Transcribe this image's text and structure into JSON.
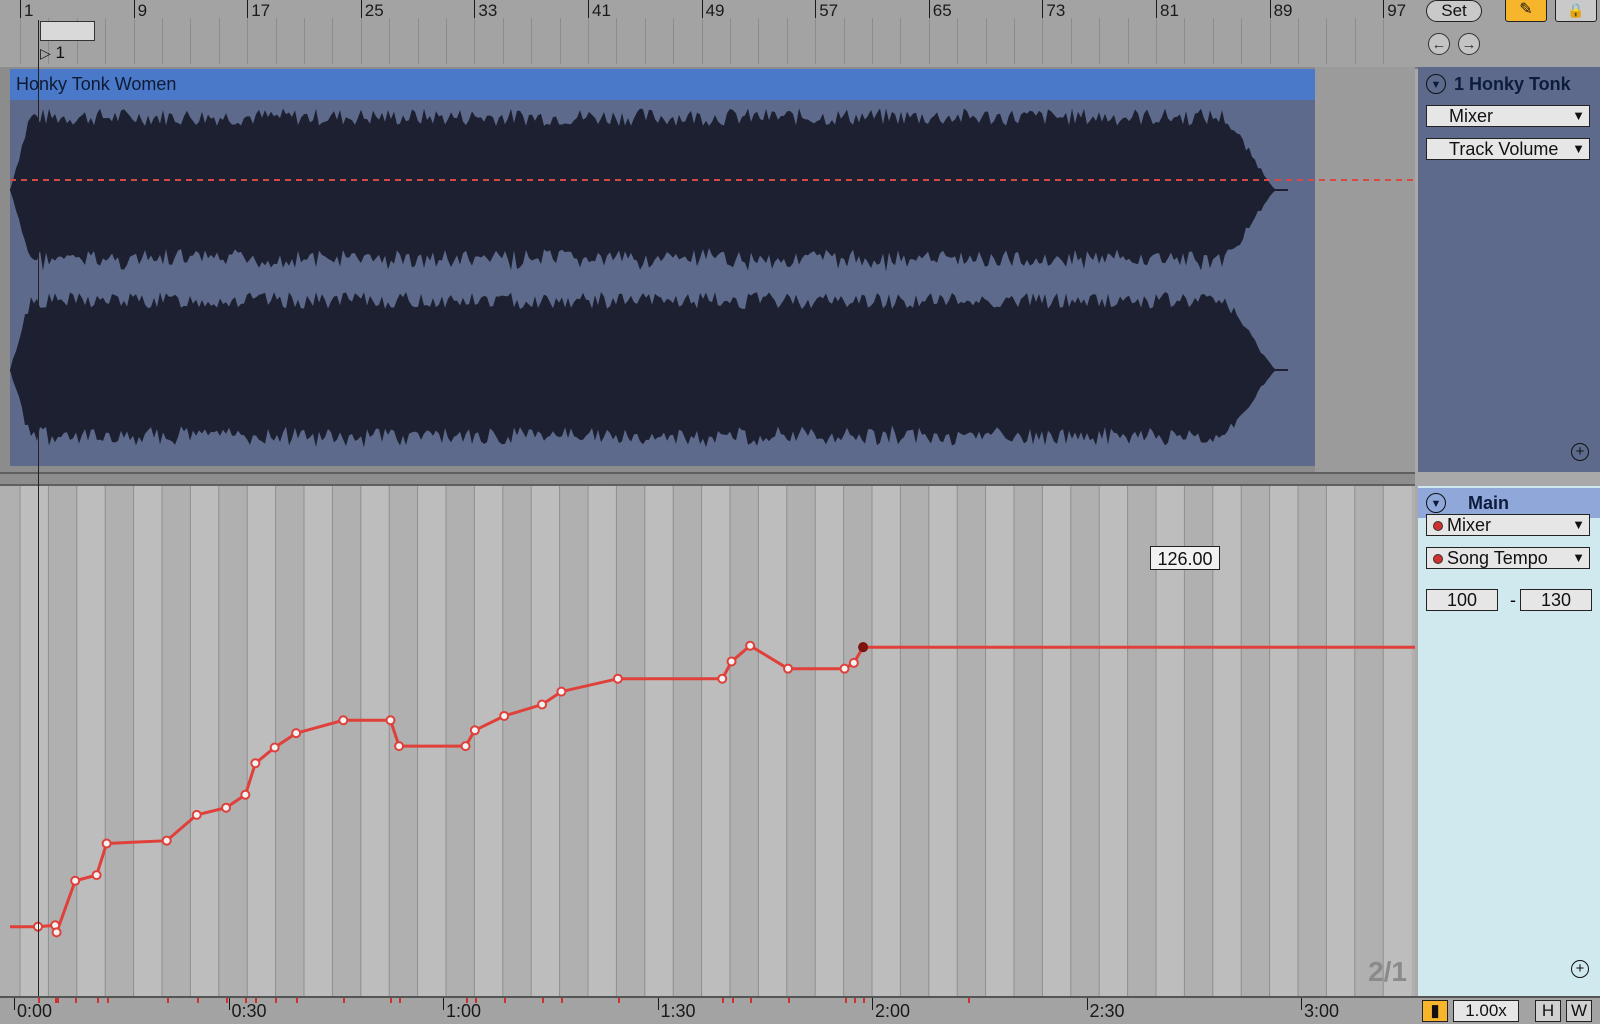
{
  "ruler": {
    "bars": [
      "1",
      "9",
      "17",
      "25",
      "33",
      "41",
      "49",
      "57",
      "65",
      "73",
      "81",
      "89",
      "97"
    ],
    "marker_label": "1"
  },
  "toolbar": {
    "set_label": "Set",
    "draw_icon": "pencil-icon",
    "lock_icon": "lock-icon",
    "back_icon": "arrow-left-icon",
    "forward_icon": "arrow-right-icon"
  },
  "clip": {
    "name": "Honky Tonk Women",
    "color": "#4b79c9"
  },
  "track_panel": {
    "title": "1 Honky Tonk",
    "device_chooser": "Mixer",
    "parameter_chooser": "Track Volume"
  },
  "main_panel": {
    "title": "Main",
    "device_chooser": "Mixer",
    "parameter_chooser": "Song Tempo",
    "range_min": "100",
    "range_sep": "-",
    "range_max": "130"
  },
  "automation": {
    "tooltip_value": "126.00",
    "grid_label": "2/1",
    "line_color": "#e0403a",
    "tempo_range": [
      100,
      130
    ],
    "breakpoints": [
      [
        0.0,
        104.0
      ],
      [
        2.4,
        104.1
      ],
      [
        2.6,
        103.6
      ],
      [
        5.2,
        107.2
      ],
      [
        8.2,
        107.6
      ],
      [
        9.6,
        109.8
      ],
      [
        18.0,
        110.0
      ],
      [
        22.2,
        111.8
      ],
      [
        26.3,
        112.3
      ],
      [
        29.0,
        113.2
      ],
      [
        30.4,
        115.4
      ],
      [
        33.1,
        116.5
      ],
      [
        36.1,
        117.5
      ],
      [
        42.7,
        118.4
      ],
      [
        49.3,
        118.4
      ],
      [
        50.5,
        116.6
      ],
      [
        59.8,
        116.6
      ],
      [
        61.1,
        117.7
      ],
      [
        65.2,
        118.7
      ],
      [
        70.5,
        119.5
      ],
      [
        73.2,
        120.4
      ],
      [
        81.1,
        121.3
      ],
      [
        95.7,
        121.3
      ],
      [
        97.0,
        122.5
      ],
      [
        99.6,
        123.6
      ],
      [
        104.9,
        122.0
      ],
      [
        112.8,
        122.0
      ],
      [
        114.1,
        122.4
      ],
      [
        115.4,
        123.5
      ],
      [
        130.0,
        123.5
      ]
    ]
  },
  "time_ruler": {
    "labels": [
      "0:00",
      "0:30",
      "1:00",
      "1:30",
      "2:00",
      "2:30",
      "3:00"
    ]
  },
  "status": {
    "zoom": "1.00x",
    "h_label": "H",
    "w_label": "W"
  }
}
